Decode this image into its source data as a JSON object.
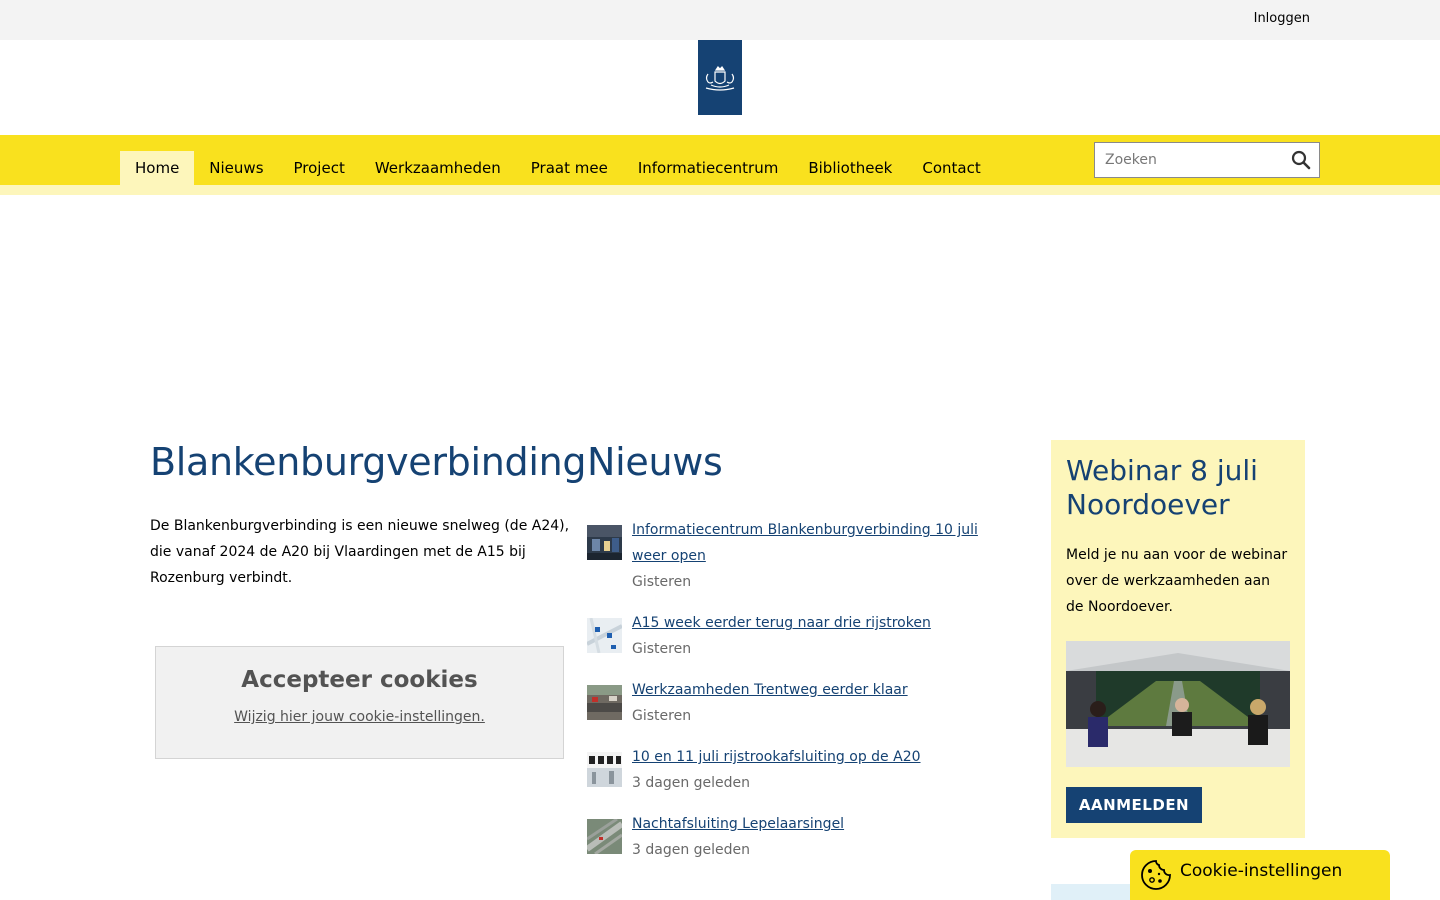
{
  "topbar": {
    "login_label": "Inloggen"
  },
  "logo": {
    "icon": "coat-of-arms-icon",
    "background": "#154273"
  },
  "nav": {
    "items": [
      {
        "label": "Home",
        "active": true
      },
      {
        "label": "Nieuws",
        "active": false
      },
      {
        "label": "Project",
        "active": false
      },
      {
        "label": "Werkzaamheden",
        "active": false
      },
      {
        "label": "Praat mee",
        "active": false
      },
      {
        "label": "Informatiecentrum",
        "active": false
      },
      {
        "label": "Bibliotheek",
        "active": false
      },
      {
        "label": "Contact",
        "active": false
      }
    ],
    "search_placeholder": "Zoeken",
    "search_value": ""
  },
  "intro": {
    "title": "Blankenburgverbinding",
    "text": "De Blankenburgverbinding is een nieuwe snelweg (de A24), die vanaf 2024 de A20 bij Vlaardingen met de A15 bij Rozenburg verbindt."
  },
  "cookie_box": {
    "title": "Accepteer cookies",
    "link": "Wijzig hier jouw cookie-instellingen."
  },
  "news": {
    "title": "Nieuws",
    "items": [
      {
        "title": "Informatiecentrum Blankenburgverbinding 10 juli weer open",
        "date": "Gisteren"
      },
      {
        "title": "A15 week eerder terug naar drie rijstroken",
        "date": "Gisteren"
      },
      {
        "title": "Werkzaamheden Trentweg eerder klaar",
        "date": "Gisteren"
      },
      {
        "title": "10 en 11 juli rijstrookafsluiting op de A20",
        "date": "3 dagen geleden"
      },
      {
        "title": "Nachtafsluiting Lepelaarsingel",
        "date": "3 dagen geleden"
      }
    ]
  },
  "webinar": {
    "title": "Webinar 8 juli Noordoever",
    "text": "Meld je nu aan voor de webinar over de werkzaamheden aan de Noordoever.",
    "button": "AANMELDEN"
  },
  "cookie_settings": {
    "label": "Cookie-instellingen",
    "icon": "cookie-icon"
  },
  "colors": {
    "brand_blue": "#154273",
    "yellow": "#f9e11e",
    "light_yellow": "#fdf6bb"
  }
}
